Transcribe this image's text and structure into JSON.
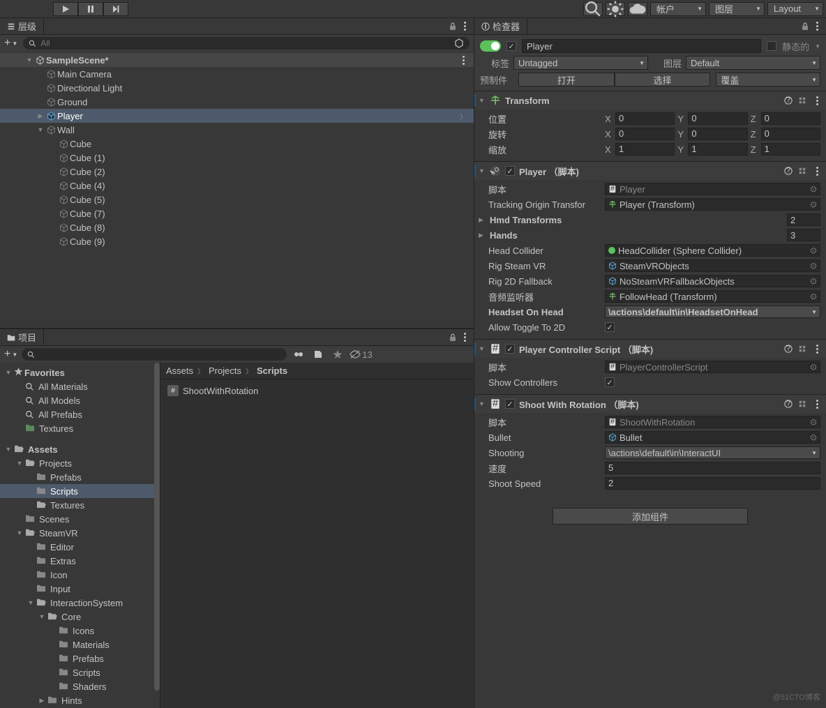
{
  "toolbar": {
    "account_label": "帐户",
    "layers_label": "图层",
    "layout_label": "Layout"
  },
  "hierarchy": {
    "tab_label": "层级",
    "search_placeholder": "All",
    "scene": "SampleScene*",
    "items": [
      {
        "name": "Main Camera",
        "indent": 2
      },
      {
        "name": "Directional Light",
        "indent": 2
      },
      {
        "name": "Ground",
        "indent": 2
      },
      {
        "name": "Player",
        "indent": 2,
        "selected": true,
        "prefab": true,
        "hasArrow": true
      },
      {
        "name": "Wall",
        "indent": 2,
        "expanded": true
      },
      {
        "name": "Cube",
        "indent": 3
      },
      {
        "name": "Cube (1)",
        "indent": 3
      },
      {
        "name": "Cube (2)",
        "indent": 3
      },
      {
        "name": "Cube (4)",
        "indent": 3
      },
      {
        "name": "Cube (5)",
        "indent": 3
      },
      {
        "name": "Cube (7)",
        "indent": 3
      },
      {
        "name": "Cube (8)",
        "indent": 3
      },
      {
        "name": "Cube (9)",
        "indent": 3
      }
    ]
  },
  "project": {
    "tab_label": "项目",
    "hidden_count": "13",
    "favorites_label": "Favorites",
    "favorites": [
      "All Materials",
      "All Models",
      "All Prefabs"
    ],
    "textures_fav": "Textures",
    "assets_label": "Assets",
    "tree": [
      {
        "name": "Projects",
        "indent": 1,
        "expanded": true
      },
      {
        "name": "Prefabs",
        "indent": 2,
        "folder": true
      },
      {
        "name": "Scripts",
        "indent": 2,
        "folder": true,
        "selected": true
      },
      {
        "name": "Textures",
        "indent": 2,
        "folder_open": true
      },
      {
        "name": "Scenes",
        "indent": 1,
        "folder": true
      },
      {
        "name": "SteamVR",
        "indent": 1,
        "expanded": true
      },
      {
        "name": "Editor",
        "indent": 2,
        "folder": true
      },
      {
        "name": "Extras",
        "indent": 2,
        "folder": true
      },
      {
        "name": "Icon",
        "indent": 2,
        "folder": true
      },
      {
        "name": "Input",
        "indent": 2,
        "folder": true
      },
      {
        "name": "InteractionSystem",
        "indent": 2,
        "expanded": true
      },
      {
        "name": "Core",
        "indent": 3,
        "expanded": true
      },
      {
        "name": "Icons",
        "indent": 4,
        "folder": true
      },
      {
        "name": "Materials",
        "indent": 4,
        "folder": true
      },
      {
        "name": "Prefabs",
        "indent": 4,
        "folder": true
      },
      {
        "name": "Scripts",
        "indent": 4,
        "folder": true
      },
      {
        "name": "Shaders",
        "indent": 4,
        "folder": true
      },
      {
        "name": "Hints",
        "indent": 3,
        "folder": true,
        "hasArrow": true
      }
    ],
    "breadcrumb": [
      "Assets",
      "Projects",
      "Scripts"
    ],
    "content": [
      {
        "name": "ShootWithRotation",
        "type": "script"
      }
    ]
  },
  "inspector": {
    "tab_label": "检查器",
    "name": "Player",
    "static_label": "静态的",
    "tag_label": "标签",
    "tag_value": "Untagged",
    "layer_label": "图层",
    "layer_value": "Default",
    "prefab_label": "预制件",
    "open_label": "打开",
    "select_label": "选择",
    "overrides_label": "覆盖",
    "transform": {
      "title": "Transform",
      "position_label": "位置",
      "rotation_label": "旋转",
      "scale_label": "缩放",
      "px": "0",
      "py": "0",
      "pz": "0",
      "rx": "0",
      "ry": "0",
      "rz": "0",
      "sx": "1",
      "sy": "1",
      "sz": "1"
    },
    "player_comp": {
      "title": "Player （脚本)",
      "script_label": "脚本",
      "script_value": "Player",
      "tracking_label": "Tracking Origin Transfor",
      "tracking_value": "Player (Transform)",
      "hmd_label": "Hmd Transforms",
      "hmd_count": "2",
      "hands_label": "Hands",
      "hands_count": "3",
      "head_collider_label": "Head Collider",
      "head_collider_value": "HeadCollider (Sphere Collider)",
      "rig_vr_label": "Rig Steam VR",
      "rig_vr_value": "SteamVRObjects",
      "rig_2d_label": "Rig 2D Fallback",
      "rig_2d_value": "NoSteamVRFallbackObjects",
      "audio_label": "音频监听器",
      "audio_value": "FollowHead (Transform)",
      "headset_label": "Headset On Head",
      "headset_value": "\\actions\\default\\in\\HeadsetOnHead",
      "toggle2d_label": "Allow Toggle To 2D"
    },
    "controller_comp": {
      "title": "Player Controller Script （脚本)",
      "script_label": "脚本",
      "script_value": "PlayerControllerScript",
      "show_label": "Show Controllers"
    },
    "shoot_comp": {
      "title": "Shoot With Rotation （脚本)",
      "script_label": "脚本",
      "script_value": "ShootWithRotation",
      "bullet_label": "Bullet",
      "bullet_value": "Bullet",
      "shooting_label": "Shooting",
      "shooting_value": "\\actions\\default\\in\\InteractUI",
      "speed_label": "速度",
      "speed_value": "5",
      "shoot_speed_label": "Shoot Speed",
      "shoot_speed_value": "2"
    },
    "add_component_label": "添加组件"
  },
  "watermark": "@51CTO博客"
}
